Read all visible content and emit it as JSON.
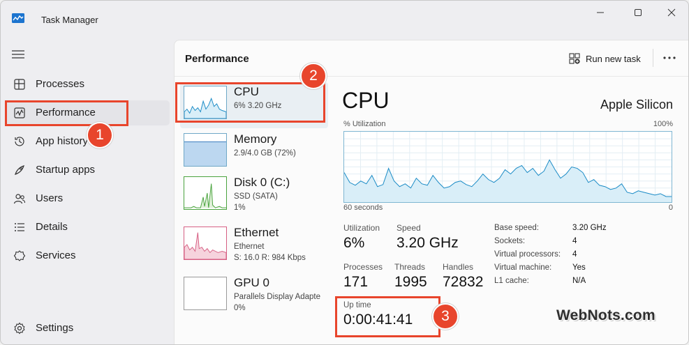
{
  "window": {
    "title": "Task Manager"
  },
  "sidebar": {
    "items": [
      {
        "label": "Processes",
        "icon": "processes-icon"
      },
      {
        "label": "Performance",
        "icon": "performance-icon",
        "active": true
      },
      {
        "label": "App history",
        "icon": "history-icon"
      },
      {
        "label": "Startup apps",
        "icon": "startup-icon"
      },
      {
        "label": "Users",
        "icon": "users-icon"
      },
      {
        "label": "Details",
        "icon": "details-icon"
      },
      {
        "label": "Services",
        "icon": "services-icon"
      }
    ],
    "settings_label": "Settings"
  },
  "header": {
    "title": "Performance",
    "run_new_task": "Run new task"
  },
  "perf_list": [
    {
      "name": "CPU",
      "sub1": "6%  3.20 GHz",
      "sub2": ""
    },
    {
      "name": "Memory",
      "sub1": "2.9/4.0 GB (72%)",
      "sub2": ""
    },
    {
      "name": "Disk 0 (C:)",
      "sub1": "SSD (SATA)",
      "sub2": "1%"
    },
    {
      "name": "Ethernet",
      "sub1": "Ethernet",
      "sub2": "S: 16.0  R: 984 Kbps"
    },
    {
      "name": "GPU 0",
      "sub1": "Parallels Display Adapte",
      "sub2": "0%"
    }
  ],
  "detail": {
    "title": "CPU",
    "model": "Apple Silicon",
    "util_label": "% Utilization",
    "util_max": "100%",
    "x_left": "60 seconds",
    "x_right": "0",
    "stats": {
      "utilization": {
        "label": "Utilization",
        "value": "6%"
      },
      "speed": {
        "label": "Speed",
        "value": "3.20 GHz"
      },
      "processes": {
        "label": "Processes",
        "value": "171"
      },
      "threads": {
        "label": "Threads",
        "value": "1995"
      },
      "handles": {
        "label": "Handles",
        "value": "72832"
      },
      "uptime": {
        "label": "Up time",
        "value": "0:00:41:41"
      }
    },
    "info": [
      {
        "key": "Base speed:",
        "value": "3.20 GHz"
      },
      {
        "key": "Sockets:",
        "value": "4"
      },
      {
        "key": "Virtual processors:",
        "value": "4"
      },
      {
        "key": "Virtual machine:",
        "value": "Yes"
      },
      {
        "key": "L1 cache:",
        "value": "N/A"
      }
    ]
  },
  "annotations": {
    "badge1": "1",
    "badge2": "2",
    "badge3": "3"
  },
  "watermark": "WebNots.com",
  "cpu_history": [
    42,
    28,
    24,
    30,
    26,
    38,
    22,
    25,
    48,
    30,
    22,
    26,
    20,
    34,
    26,
    24,
    38,
    28,
    20,
    22,
    28,
    30,
    25,
    22,
    30,
    40,
    32,
    28,
    34,
    46,
    40,
    48,
    52,
    42,
    48,
    38,
    44,
    60,
    46,
    34,
    40,
    50,
    48,
    42,
    28,
    32,
    24,
    22,
    18,
    20,
    26,
    14,
    12,
    16,
    14,
    12,
    10,
    12,
    8,
    8
  ],
  "colors": {
    "accent": "#e8452c",
    "cpu_line": "#1a8bc6",
    "cpu_fill": "#d9eef8",
    "mem_fill": "#bcd7f0",
    "disk_line": "#4aa33e",
    "eth_line": "#d65f83"
  }
}
